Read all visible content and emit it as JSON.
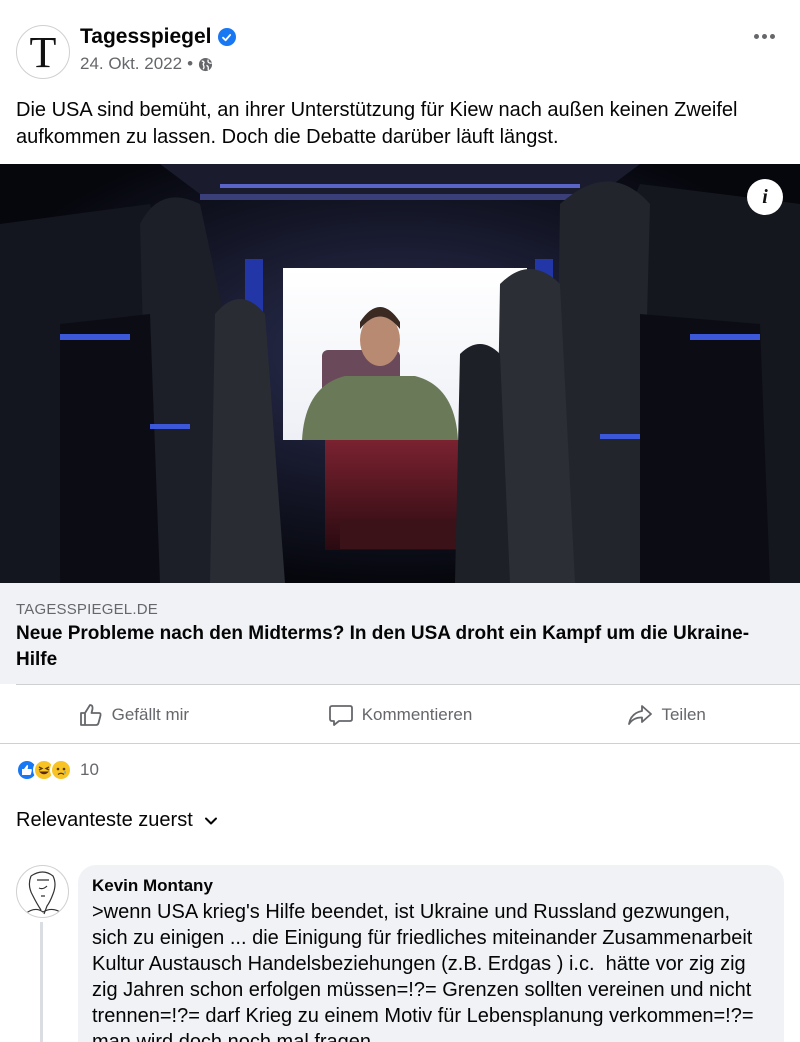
{
  "post": {
    "page_name": "Tagesspiegel",
    "avatar_letter": "T",
    "date": "24. Okt. 2022",
    "separator": "•",
    "visibility_icon": "globe-icon",
    "text": "Die USA sind bemüht, an ihrer Unterstützung für Kiew nach außen keinen Zweifel aufkommen zu lassen. Doch die Debatte darüber läuft längst.",
    "info_label": "i"
  },
  "link": {
    "domain": "TAGESSPIEGEL.DE",
    "title": "Neue Probleme nach den Midterms? In den USA droht ein Kampf um die Ukraine-Hilfe"
  },
  "actions": {
    "like": "Gefällt mir",
    "comment": "Kommentieren",
    "share": "Teilen"
  },
  "reactions": {
    "types": [
      "like",
      "haha",
      "sad"
    ],
    "count": "10"
  },
  "sort": {
    "label": "Relevanteste zuerst"
  },
  "comment": {
    "author": "Kevin Montany",
    "text": ">wenn USA krieg's Hilfe beendet, ist Ukraine und Russland gezwungen, sich zu einigen ... die Einigung für friedliches miteinander Zusammenarbeit Kultur Austausch Handelsbeziehungen (z.B. Erdgas ) i.c.  hätte vor zig zig zig Jahren schon erfolgen müssen=!?= Grenzen sollten vereinen und nicht trennen=!?= darf Krieg zu einem Motiv für Lebensplanung verkommen=!?= man wird doch noch mal fragen"
  },
  "colors": {
    "accent": "#1877f2",
    "secondary_text": "#65676b",
    "link_box_bg": "#f0f2f5"
  }
}
